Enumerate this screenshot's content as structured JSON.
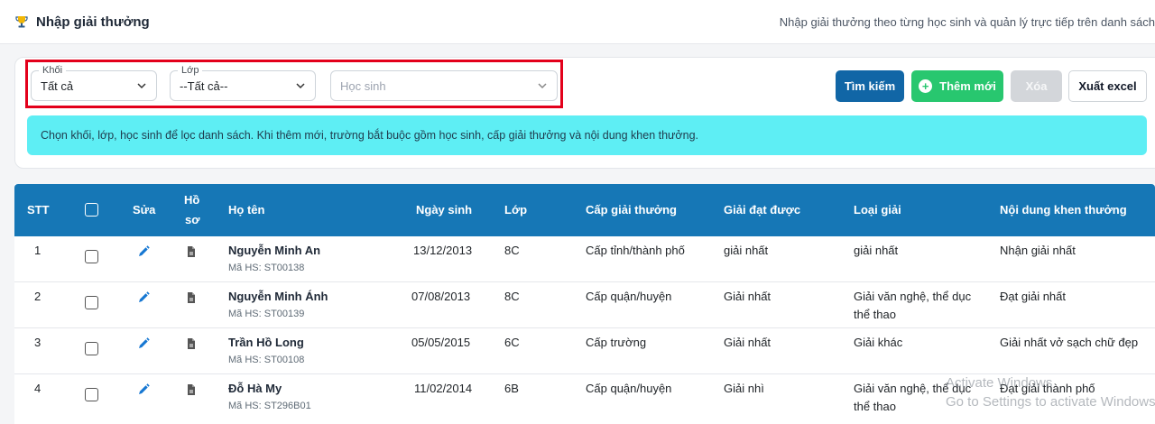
{
  "header": {
    "title": "Nhập giải thưởng",
    "description": "Nhập giải thưởng theo từng học sinh và quản lý trực tiếp trên danh sách"
  },
  "filters": {
    "khoi": {
      "label": "Khối",
      "value": "Tất cả"
    },
    "lop": {
      "label": "Lớp",
      "value": "--Tất cả--"
    },
    "hoc_sinh": {
      "placeholder": "Học sinh"
    }
  },
  "buttons": {
    "search": "Tìm kiếm",
    "add": "Thêm mới",
    "delete": "Xóa",
    "export": "Xuất excel"
  },
  "note": "Chọn khối, lớp, học sinh để lọc danh sách. Khi thêm mới, trường bắt buộc gồm học sinh, cấp giải thưởng và nội dung khen thưởng.",
  "table": {
    "headers": {
      "stt": "STT",
      "edit": "Sửa",
      "profile_1": "Hồ",
      "profile_2": "sơ",
      "name": "Họ tên",
      "dob": "Ngày sinh",
      "class": "Lớp",
      "level": "Cấp giải thưởng",
      "award": "Giải đạt được",
      "type": "Loại giải",
      "content": "Nội dung khen thưởng"
    },
    "rows": [
      {
        "stt": "1",
        "name": "Nguyễn Minh An",
        "code": "Mã HS: ST00138",
        "dob": "13/12/2013",
        "class": "8C",
        "level": "Cấp tỉnh/thành phố",
        "award": "giải nhất",
        "type": "giải nhất",
        "type2": "",
        "content": "Nhận giải nhất"
      },
      {
        "stt": "2",
        "name": "Nguyễn Minh Ánh",
        "code": "Mã HS: ST00139",
        "dob": "07/08/2013",
        "class": "8C",
        "level": "Cấp quận/huyện",
        "award": "Giải nhất",
        "type": "Giải văn nghệ, thể dục",
        "type2": "thể thao",
        "content": "Đạt giải nhất"
      },
      {
        "stt": "3",
        "name": "Trần Hồ Long",
        "code": "Mã HS: ST00108",
        "dob": "05/05/2015",
        "class": "6C",
        "level": "Cấp trường",
        "award": "Giải nhất",
        "type": "Giải khác",
        "type2": "",
        "content": "Giải nhất vở sạch chữ đẹp"
      },
      {
        "stt": "4",
        "name": "Đỗ Hà My",
        "code": "Mã HS: ST296B01",
        "dob": "11/02/2014",
        "class": "6B",
        "level": "Cấp quận/huyện",
        "award": "Giải nhì",
        "type": "Giải văn nghệ, thể dục",
        "type2": "thể thao",
        "content": "Đạt giải thành phố"
      }
    ]
  },
  "watermark": {
    "line1": "Activate Windows",
    "line2": "Go to Settings to activate Windows."
  },
  "colors": {
    "primary": "#1166a6",
    "table_header": "#1677b6",
    "success": "#28c76f",
    "info_note": "#5eeef4",
    "highlight": "#e3001b"
  }
}
